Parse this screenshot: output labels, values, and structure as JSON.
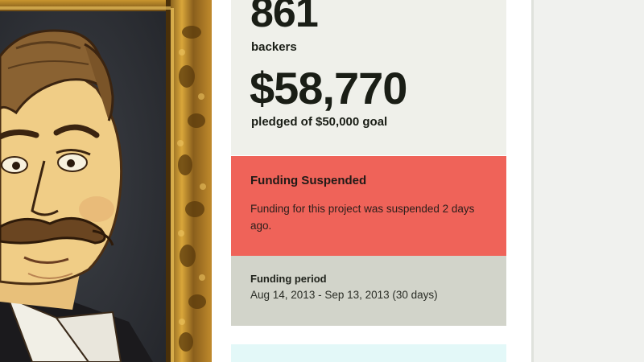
{
  "stats": {
    "backers_count": "861",
    "backers_label": "backers",
    "pledged_amount": "$58,770",
    "pledged_label": "pledged of $50,000 goal"
  },
  "status": {
    "title": "Funding Suspended",
    "message": "Funding for this project was suspended 2 days ago."
  },
  "funding_period": {
    "title": "Funding period",
    "dates": "Aug 14, 2013 - Sep 13, 2013 (30 days)"
  },
  "colors": {
    "suspended_bg": "#ef6359",
    "period_bg": "#d2d4ca",
    "stats_bg": "#eff0ea",
    "text_dark": "#1a1e16",
    "frame_gold": "#b8862b"
  }
}
